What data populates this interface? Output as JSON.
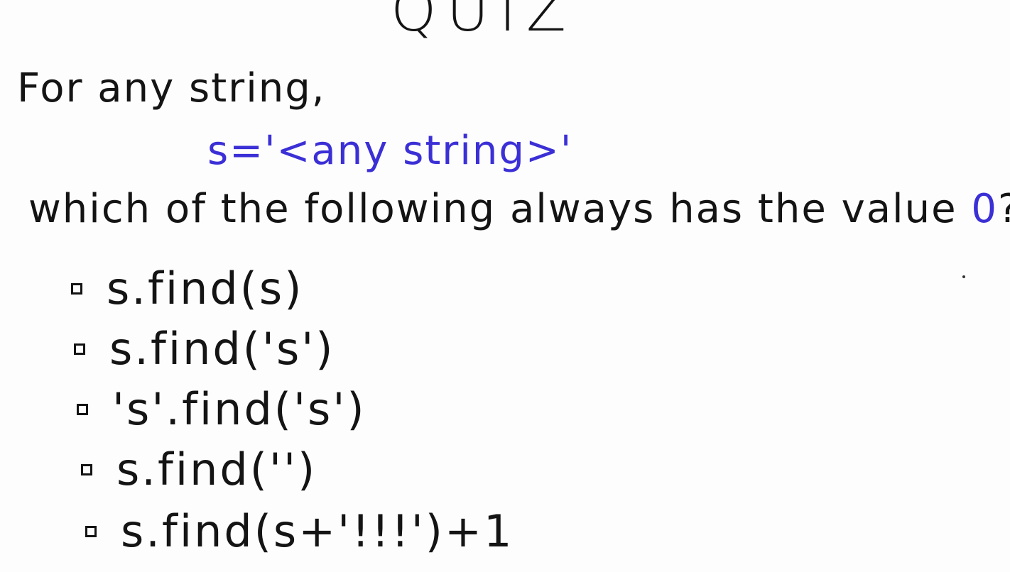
{
  "title": "QUIZ",
  "prompt_line1": "For any string,",
  "code_line": "s='<any string>'",
  "prompt_line2_before": "which of the following always has the value ",
  "prompt_value": "0",
  "prompt_line2_after": "?",
  "options": [
    {
      "label": "s.find(s)"
    },
    {
      "label": "s.find('s')"
    },
    {
      "label": "'s'.find('s')"
    },
    {
      "label": "s.find('')"
    },
    {
      "label": "s.find(s+'!!!')+1"
    }
  ],
  "colors": {
    "ink": "#141414",
    "accent": "#3b2fd6",
    "background": "#fdfdfd"
  }
}
